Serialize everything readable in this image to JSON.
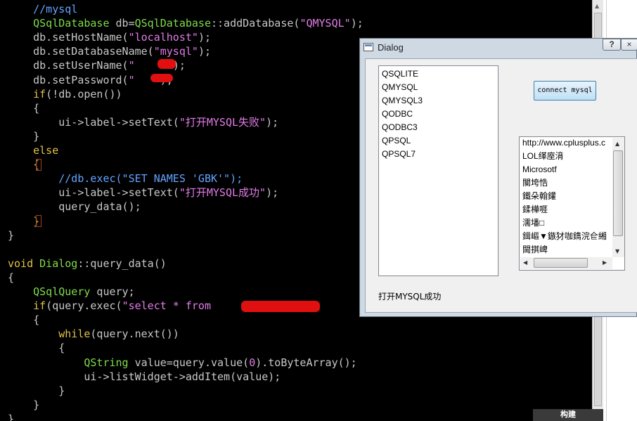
{
  "editor": {
    "lines": [
      [
        {
          "t": "    ",
          "c": "default"
        },
        {
          "t": "//mysql",
          "c": "comment"
        }
      ],
      [
        {
          "t": "    ",
          "c": "default"
        },
        {
          "t": "QSqlDatabase",
          "c": "type"
        },
        {
          "t": " db=",
          "c": "default"
        },
        {
          "t": "QSqlDatabase",
          "c": "type"
        },
        {
          "t": "::addDatabase(",
          "c": "default"
        },
        {
          "t": "\"QMYSQL\"",
          "c": "str"
        },
        {
          "t": ");",
          "c": "default"
        }
      ],
      [
        {
          "t": "    db.setHostName(",
          "c": "default"
        },
        {
          "t": "\"localhost\"",
          "c": "str"
        },
        {
          "t": ");",
          "c": "default"
        }
      ],
      [
        {
          "t": "    db.setDatabaseName(",
          "c": "default"
        },
        {
          "t": "\"mysql\"",
          "c": "str"
        },
        {
          "t": ");",
          "c": "default"
        }
      ],
      [
        {
          "t": "    db.setUserName(",
          "c": "default"
        },
        {
          "t": "\"",
          "c": "str"
        },
        {
          "t": "    ",
          "c": "default"
        },
        {
          "t": "t\"",
          "c": "str"
        },
        {
          "t": ");",
          "c": "default"
        }
      ],
      [
        {
          "t": "    db.setPassword(",
          "c": "default"
        },
        {
          "t": "\"",
          "c": "str"
        },
        {
          "t": "   ",
          "c": "default"
        },
        {
          "t": "\"",
          "c": "str"
        },
        {
          "t": ");",
          "c": "default"
        }
      ],
      [
        {
          "t": "    ",
          "c": "default"
        },
        {
          "t": "if",
          "c": "kw"
        },
        {
          "t": "(!db.open())",
          "c": "default"
        }
      ],
      [
        {
          "t": "    {",
          "c": "default"
        }
      ],
      [
        {
          "t": "        ui->label->setText(",
          "c": "default"
        },
        {
          "t": "\"打开MYSQL失败\"",
          "c": "str"
        },
        {
          "t": ");",
          "c": "default"
        }
      ],
      [
        {
          "t": "    }",
          "c": "default"
        }
      ],
      [
        {
          "t": "    ",
          "c": "default"
        },
        {
          "t": "else",
          "c": "kw"
        }
      ],
      [
        {
          "t": "    ",
          "c": "default"
        },
        {
          "t": "{",
          "c": "kw"
        }
      ],
      [
        {
          "t": "        ",
          "c": "default"
        },
        {
          "t": "//db.exec(\"SET NAMES 'GBK'\");",
          "c": "comment"
        }
      ],
      [
        {
          "t": "        ui->label->setText(",
          "c": "default"
        },
        {
          "t": "\"打开MYSQL成功\"",
          "c": "str"
        },
        {
          "t": ");",
          "c": "default"
        }
      ],
      [
        {
          "t": "        query_data();",
          "c": "default"
        }
      ],
      [
        {
          "t": "    ",
          "c": "default"
        },
        {
          "t": "}",
          "c": "kw"
        }
      ],
      [
        {
          "t": "}",
          "c": "default"
        }
      ],
      [
        {
          "t": "",
          "c": "default"
        }
      ],
      [
        {
          "t": "void",
          "c": "kw"
        },
        {
          "t": " ",
          "c": "default"
        },
        {
          "t": "Dialog",
          "c": "type"
        },
        {
          "t": "::query_data()",
          "c": "default"
        }
      ],
      [
        {
          "t": "{",
          "c": "default"
        }
      ],
      [
        {
          "t": "    ",
          "c": "default"
        },
        {
          "t": "QSqlQuery",
          "c": "type"
        },
        {
          "t": " query;",
          "c": "default"
        }
      ],
      [
        {
          "t": "    ",
          "c": "default"
        },
        {
          "t": "if",
          "c": "kw"
        },
        {
          "t": "(query.exec(",
          "c": "default"
        },
        {
          "t": "\"select * from ",
          "c": "str"
        },
        {
          "t": "           ",
          "c": "default"
        },
        {
          "t": "\"",
          "c": "str"
        },
        {
          "t": "))",
          "c": "default"
        }
      ],
      [
        {
          "t": "    {",
          "c": "default"
        }
      ],
      [
        {
          "t": "        ",
          "c": "default"
        },
        {
          "t": "while",
          "c": "kw"
        },
        {
          "t": "(query.next())",
          "c": "default"
        }
      ],
      [
        {
          "t": "        {",
          "c": "default"
        }
      ],
      [
        {
          "t": "            ",
          "c": "default"
        },
        {
          "t": "QString",
          "c": "type"
        },
        {
          "t": " value=query.value(",
          "c": "default"
        },
        {
          "t": "0",
          "c": "num"
        },
        {
          "t": ").toByteArray();",
          "c": "default"
        }
      ],
      [
        {
          "t": "            ui->listWidget->addItem(value);",
          "c": "default"
        }
      ],
      [
        {
          "t": "        }",
          "c": "default"
        }
      ],
      [
        {
          "t": "    }",
          "c": "default"
        }
      ],
      [
        {
          "t": "}",
          "c": "default"
        }
      ]
    ],
    "build_label": "构建"
  },
  "colors": {
    "comment": "#64a4ff",
    "type": "#7fdc4a",
    "str": "#e27ce8",
    "kw": "#e0c24a",
    "num": "#e27ce8",
    "default": "#c8c8c8",
    "redaction": "#e01010"
  },
  "dialog": {
    "title": "Dialog",
    "help_label": "?",
    "close_label": "×",
    "drivers": [
      "QSQLITE",
      "QMYSQL",
      "QMYSQL3",
      "QODBC",
      "QODBC3",
      "QPSQL",
      "QPSQL7"
    ],
    "connect_label": "connect mysql",
    "results": [
      "http://www.cplusplus.c",
      "LOL缂庢湇",
      "Microsotf",
      "闃垮悎",
      "鐵朵翰鑵",
      "鍒樺啀",
      "濡墦□",
      "鍓嶇▼鏃犲咖鐫浣仺緗",
      "閫掑崥"
    ],
    "status": "打开MYSQL成功"
  }
}
